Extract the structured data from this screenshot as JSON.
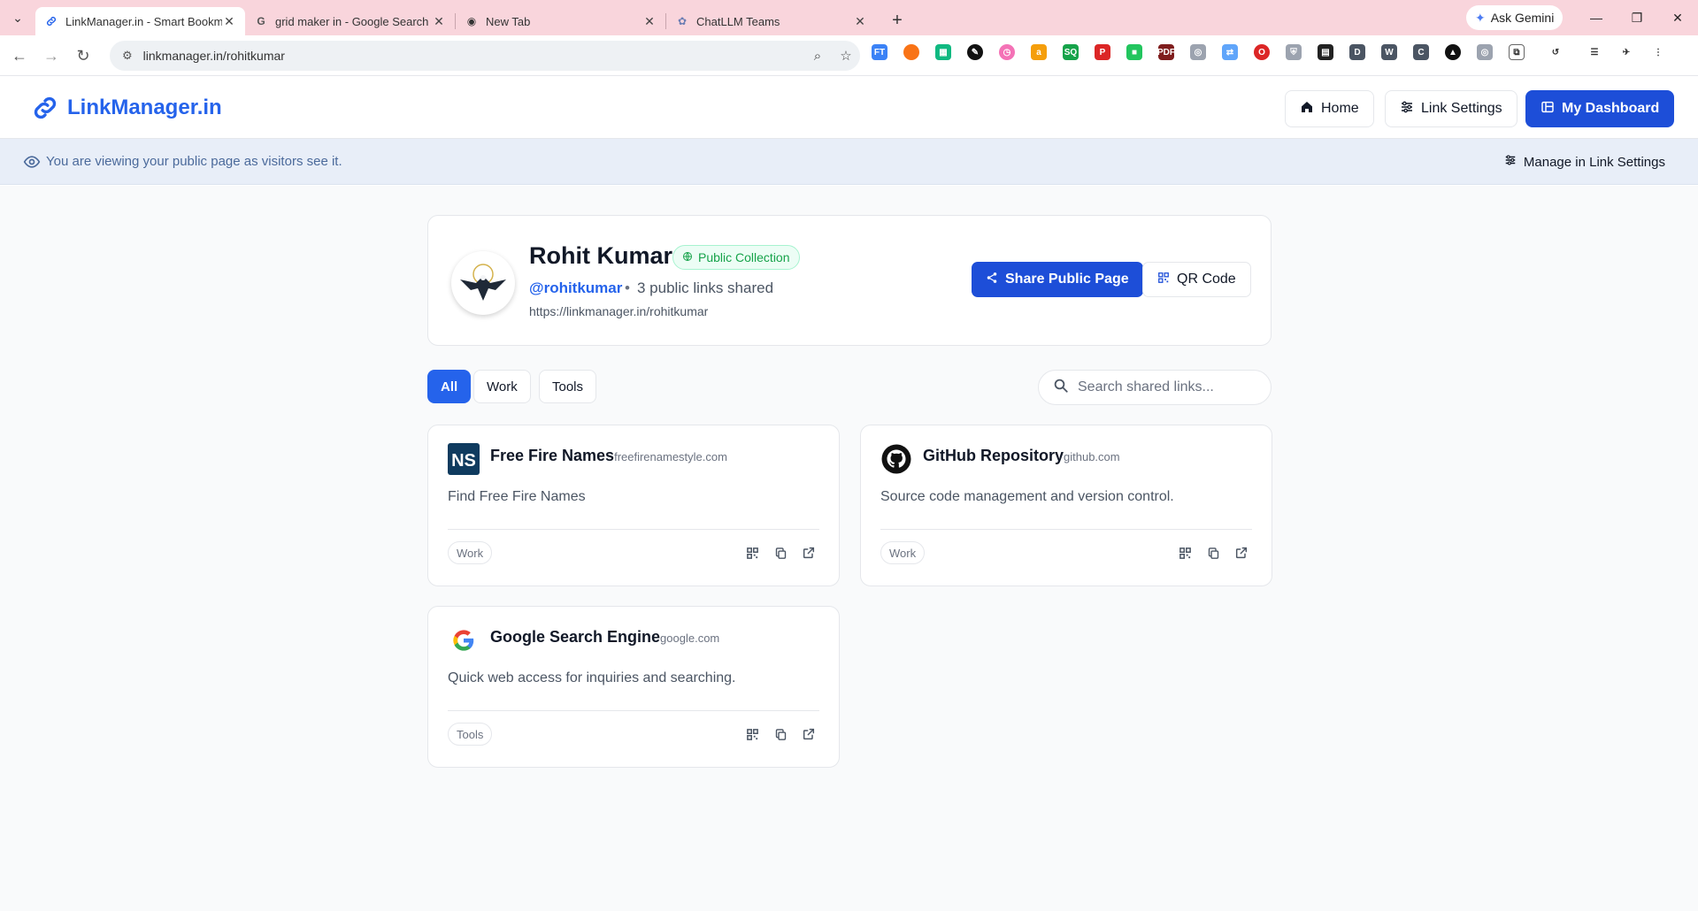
{
  "browser": {
    "tabs": [
      {
        "label": "LinkManager.in - Smart Bookma",
        "active": true
      },
      {
        "label": "grid maker in - Google Search",
        "active": false
      },
      {
        "label": "New Tab",
        "active": false
      },
      {
        "label": "ChatLLM Teams",
        "active": false
      }
    ],
    "gemini_label": "Ask Gemini",
    "url": "linkmanager.in/rohitkumar"
  },
  "header": {
    "logo_text": "LinkManager.in",
    "home_label": "Home",
    "link_settings_label": "Link Settings",
    "dashboard_label": "My Dashboard"
  },
  "banner": {
    "text": "You are viewing your public page as visitors see it.",
    "manage_label": "Manage in Link Settings"
  },
  "profile": {
    "name": "Rohit Kumar",
    "badge": "Public Collection",
    "handle": "@rohitkumar",
    "separator": "•",
    "count_text": "3 public links shared",
    "url": "https://linkmanager.in/rohitkumar",
    "share_label": "Share Public Page",
    "qr_label": "QR Code"
  },
  "filters": [
    "All",
    "Work",
    "Tools"
  ],
  "search": {
    "placeholder": "Search shared links..."
  },
  "links": [
    {
      "title": "Free Fire Names",
      "domain": "freefirenamestyle.com",
      "description": "Find Free Fire Names",
      "tag": "Work",
      "icon": "ns-logo-icon"
    },
    {
      "title": "GitHub Repository",
      "domain": "github.com",
      "description": "Source code management and version control.",
      "tag": "Work",
      "icon": "github-icon"
    },
    {
      "title": "Google Search Engine",
      "domain": "google.com",
      "description": "Quick web access for inquiries and searching.",
      "tag": "Tools",
      "icon": "google-icon"
    }
  ],
  "colors": {
    "primary": "#1d4ed8",
    "accent": "#2563eb",
    "tabbar": "#f9d5dc",
    "banner": "#e8eef8"
  }
}
